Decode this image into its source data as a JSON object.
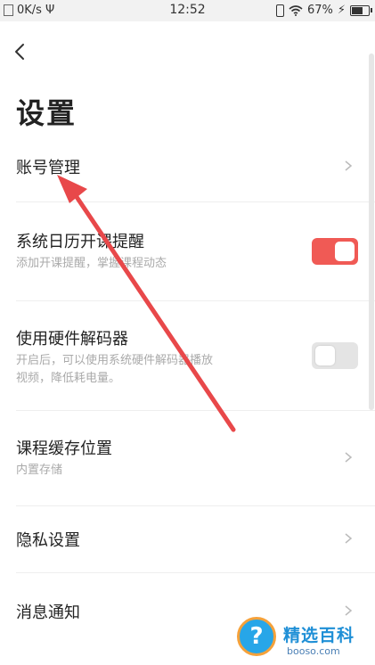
{
  "status_bar": {
    "network_speed": "0K/s",
    "usb_symbol": "Ψ",
    "time": "12:52",
    "battery_percent": "67%",
    "battery_level": 0.67
  },
  "page": {
    "title": "设置"
  },
  "settings": {
    "account": {
      "title": "账号管理"
    },
    "calendar": {
      "title": "系统日历开课提醒",
      "subtitle": "添加开课提醒，掌握课程动态",
      "enabled": true
    },
    "hw_decoder": {
      "title": "使用硬件解码器",
      "subtitle_line1": "开启后，可以使用系统硬件解码器播放",
      "subtitle_line2": "视频，降低耗电量。",
      "enabled": false
    },
    "cache": {
      "title": "课程缓存位置",
      "subtitle": "内置存储"
    },
    "privacy": {
      "title": "隐私设置"
    },
    "notifications": {
      "title": "消息通知"
    }
  },
  "watermark": {
    "brand": "精选百科",
    "domain": "booso.com"
  },
  "colors": {
    "toggle_on": "#f05a55",
    "toggle_off": "#e4e4e4",
    "arrow": "#e8484a"
  }
}
